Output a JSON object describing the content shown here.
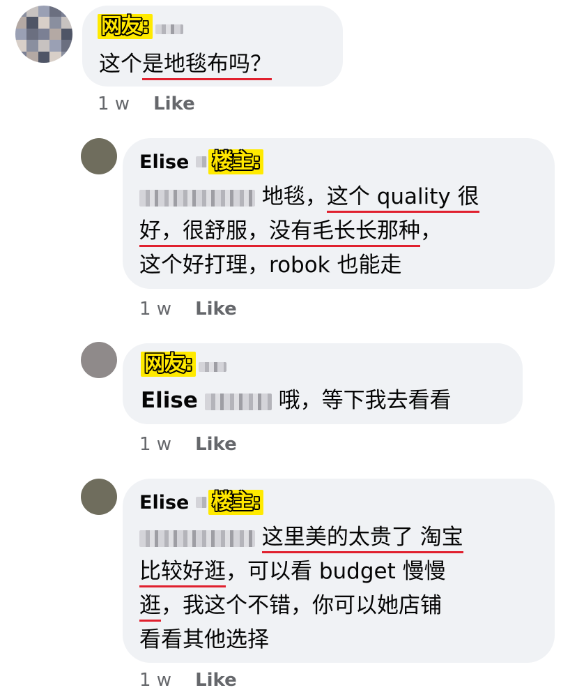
{
  "comments": [
    {
      "tag": "网友:",
      "text": "这个是地毯布吗？",
      "text_plain": "这个",
      "text_underlined": "是地毯布吗？",
      "time": "1 w",
      "like": "Like"
    },
    {
      "author": "Elise",
      "tag": "楼主:",
      "line1_plain": "地毯，",
      "line1_ul": "这个 quality 很",
      "line2_ul": "好，很舒服，没有毛长长那种",
      "line2_plain": "，",
      "line3": "这个好打理，robok 也能走",
      "time": "1 w",
      "like": "Like"
    },
    {
      "tag": "网友:",
      "author": "Elise",
      "text": "哦，等下我去看看",
      "time": "1 w",
      "like": "Like"
    },
    {
      "author": "Elise",
      "tag": "楼主:",
      "line1_ul": "这里美的太贵了 淘宝",
      "line2_ul": "比较好逛",
      "line2_plain": "，可以看 budget 慢慢",
      "line3_ul": "逛",
      "line3_plain": "，我这个不错，你可以她店铺",
      "line4": "看看其他选择",
      "time": "1 w",
      "like": "Like"
    }
  ],
  "colors": {
    "bubble": "#f0f2f5",
    "underline": "#e0202e",
    "tag": "#ffea00",
    "meta": "#65676b"
  }
}
